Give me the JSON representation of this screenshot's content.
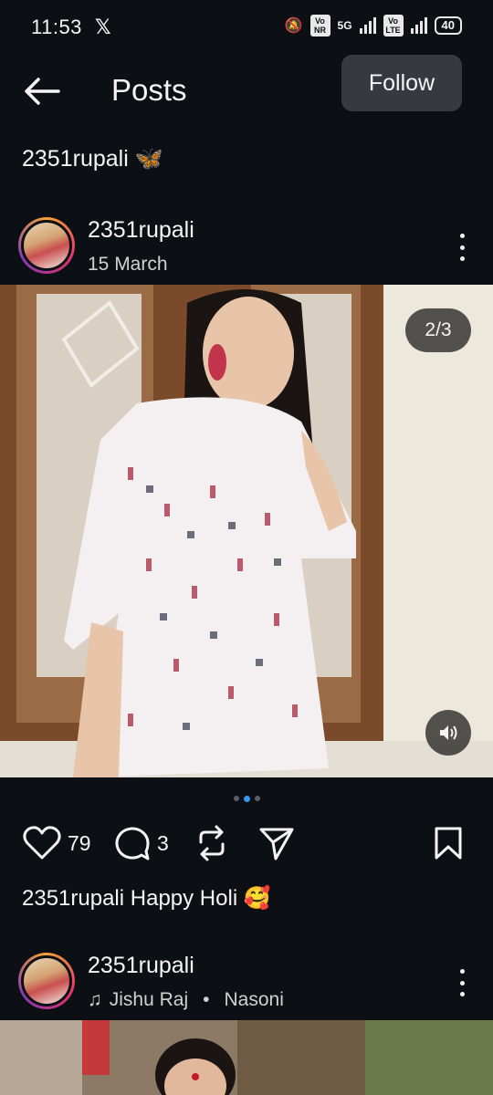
{
  "status_bar": {
    "time": "11:53",
    "x_logo": "𝕏",
    "sim1_label": "Vo NR",
    "network1": "5G",
    "sim2_label": "Vo LTE",
    "battery": "40"
  },
  "header": {
    "title": "Posts",
    "follow_label": "Follow"
  },
  "account": {
    "handle": "2351rupali",
    "emoji": "🦋"
  },
  "post1": {
    "username": "2351rupali",
    "date": "15 March",
    "image_counter": "2/3",
    "likes": "79",
    "comments": "3",
    "caption_user": "2351rupali",
    "caption_text": "Happy Holi 🥰"
  },
  "post2": {
    "username": "2351rupali",
    "music_artist": "Jishu Raj",
    "music_separator": "•",
    "music_title": "Nasoni"
  },
  "colors": {
    "background": "#0c1014",
    "follow_bg": "#363a40",
    "active_dot": "#3897f0",
    "text": "#f5f5f5"
  }
}
